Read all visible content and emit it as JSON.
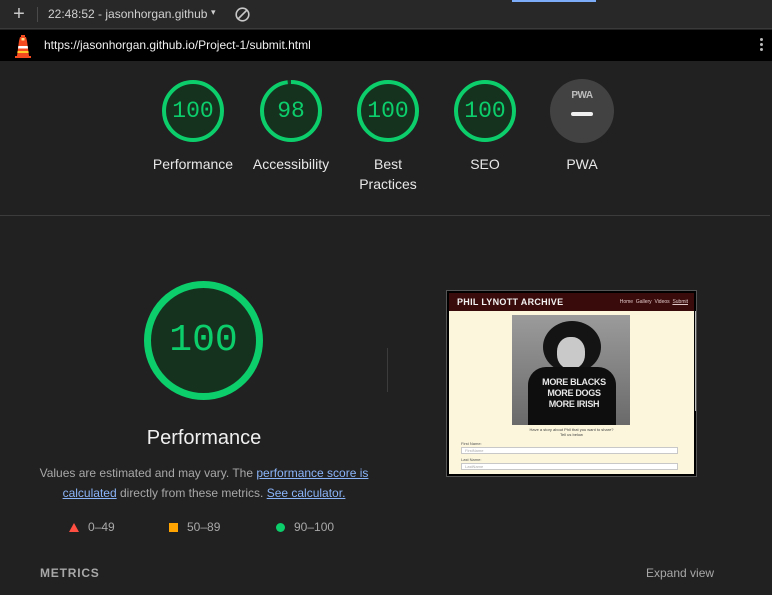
{
  "toolbar": {
    "plus_label": "+",
    "title": "22:48:52 - jasonhorgan.github",
    "caret": "▾",
    "clear_icon": "clear-icon",
    "accent_color": "#7cacf8"
  },
  "urlbar": {
    "url": "https://jasonhorgan.github.io/Project-1/submit.html",
    "logo_icon": "lighthouse-icon",
    "menu_icon": "kebab-menu-icon"
  },
  "categories": [
    {
      "label": "Performance",
      "score": "100",
      "fraction": 1.0
    },
    {
      "label": "Accessibility",
      "score": "98",
      "fraction": 0.98
    },
    {
      "label_line1": "Best",
      "label_line2": "Practices",
      "score": "100",
      "fraction": 1.0
    },
    {
      "label": "SEO",
      "score": "100",
      "fraction": 1.0
    },
    {
      "label": "PWA",
      "badge_text": "PWA"
    }
  ],
  "colors": {
    "pass": "#0cce6b",
    "average": "#ffa400",
    "fail": "#ff4e42",
    "link": "#8ab4f8"
  },
  "performance": {
    "score": "100",
    "fraction": 1.0,
    "title": "Performance",
    "desc_part1": "Values are estimated and may vary. The ",
    "desc_link1": "performance score is calculated",
    "desc_part2": " directly from these metrics. ",
    "desc_link2": "See calculator."
  },
  "legend": [
    {
      "shape": "triangle",
      "range": "0–49"
    },
    {
      "shape": "square",
      "range": "50–89"
    },
    {
      "shape": "circle",
      "range": "90–100"
    }
  ],
  "screenshot": {
    "brand": "PHIL LYNOTT ARCHIVE",
    "nav_home": "Home",
    "nav_gallery": "Gallery",
    "nav_videos": "Videos",
    "nav_submit": "Submit",
    "shirt_line1": "MORE BLACKS",
    "shirt_line2": "MORE DOGS",
    "shirt_line3": "MORE IRISH",
    "question": "Have a story about Phil that you want to share?",
    "question2": "Tell us below",
    "first_name_label": "First Name:",
    "first_name_placeholder": "FirstName",
    "last_name_label": "Last Name:",
    "last_name_placeholder": "LastName"
  },
  "metrics": {
    "heading": "METRICS",
    "expand_label": "Expand view"
  }
}
